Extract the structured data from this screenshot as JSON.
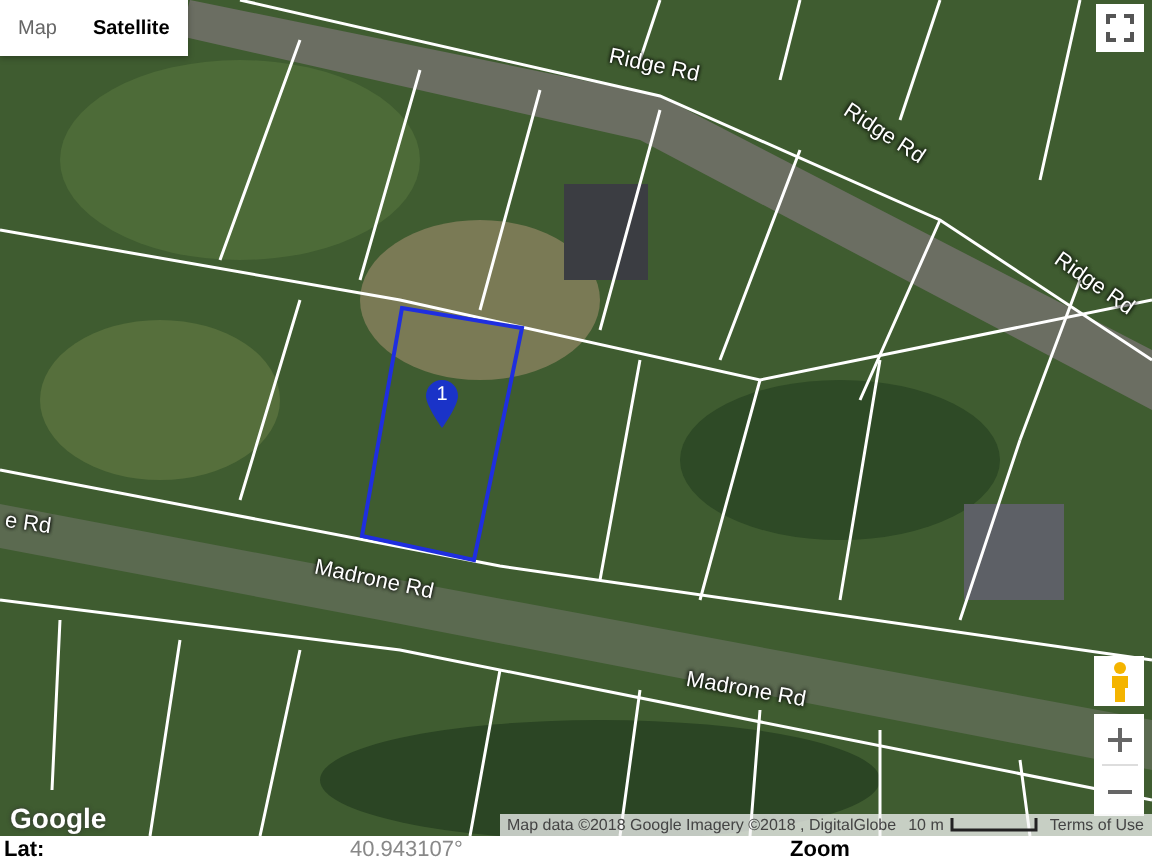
{
  "map_type_control": [
    {
      "label": "Map",
      "selected": false
    },
    {
      "label": "Satellite",
      "selected": true
    }
  ],
  "road_labels": [
    "Ridge Rd",
    "Ridge Rd",
    "Ridge Rd",
    "e Rd",
    "Madrone Rd",
    "Madrone Rd"
  ],
  "marker": {
    "label": "1"
  },
  "logo": "Google",
  "attribution": "Map data ©2018 Google Imagery ©2018 , DigitalGlobe",
  "scale": "10 m",
  "terms": "Terms of Use",
  "info_bar": {
    "lat_label": "Lat:",
    "lat_value": "40.943107°",
    "zoom_label": "Zoom"
  }
}
